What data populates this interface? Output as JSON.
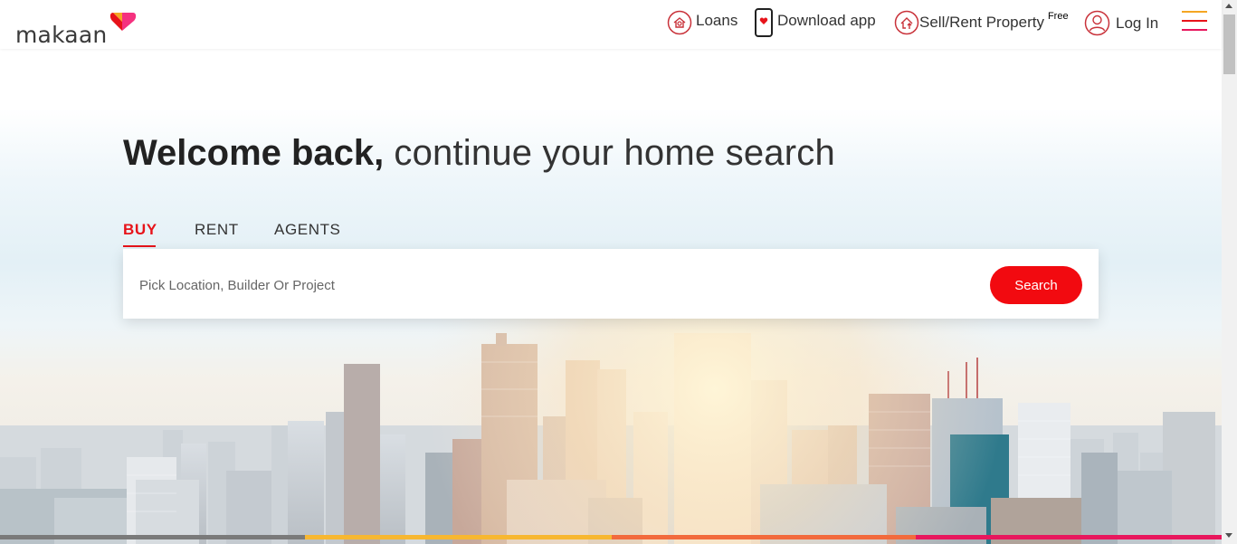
{
  "brand": {
    "name": "makaan",
    "heart_colors": [
      "#f5a623",
      "#f5317f",
      "#e7131a"
    ]
  },
  "nav": {
    "loans": {
      "label": "Loans",
      "icon": "loans-icon"
    },
    "download": {
      "label": "Download app",
      "icon": "phone-icon"
    },
    "sell": {
      "label": "Sell/Rent Property",
      "badge": "Free",
      "icon": "house-upload-icon"
    },
    "login": {
      "label": "Log In",
      "icon": "user-icon"
    },
    "menu": {
      "icon": "hamburger-menu-icon"
    }
  },
  "hero": {
    "headline_bold": "Welcome back,",
    "headline_light": "continue your home search",
    "tabs": [
      {
        "label": "BUY",
        "active": true
      },
      {
        "label": "RENT",
        "active": false
      },
      {
        "label": "AGENTS",
        "active": false
      }
    ],
    "search": {
      "placeholder": "Pick Location, Builder Or Project",
      "value": "",
      "button_label": "Search"
    }
  },
  "colors": {
    "accent": "#e7131a",
    "search_button": "#f20a10",
    "bottom_bar": [
      "#7a7a7a",
      "#f7b731",
      "#f26a3d",
      "#e8175d"
    ]
  }
}
